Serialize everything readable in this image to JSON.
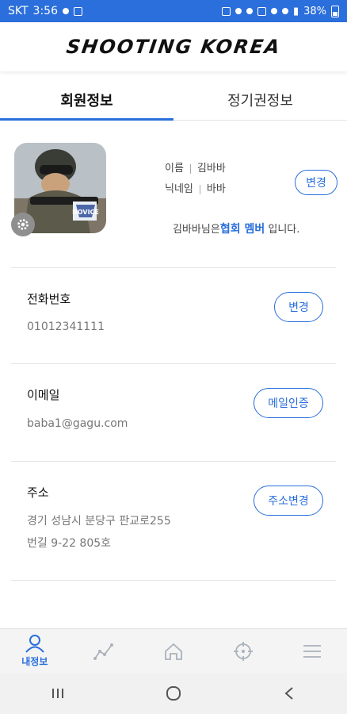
{
  "status_bar": {
    "carrier": "SKT",
    "time": "3:56",
    "battery": "38%"
  },
  "header": {
    "logo_text": "SHOOTING KOREA"
  },
  "tabs": [
    {
      "label": "회원정보",
      "active": true
    },
    {
      "label": "정기권정보",
      "active": false
    }
  ],
  "profile": {
    "avatar_badge_text": "NOVICE",
    "name_label": "이름",
    "name_value": "김바바",
    "nickname_label": "닉네임",
    "nickname_value": "바바",
    "change_button": "변경",
    "member_prefix": "김바바님은",
    "member_grade": "협회 멤버",
    "member_suffix": "입니다."
  },
  "phone": {
    "title": "전화번호",
    "value": "01012341111",
    "button": "변경"
  },
  "email": {
    "title": "이메일",
    "value": "baba1@gagu.com",
    "button": "메일인증"
  },
  "address": {
    "title": "주소",
    "line1": "경기 성남시 분당구 판교로255",
    "line2": "번길 9-22 805호",
    "button": "주소변경"
  },
  "bottom_nav": [
    {
      "label": "내정보",
      "icon": "person-icon",
      "active": true
    },
    {
      "label": "",
      "icon": "chart-line-icon",
      "active": false
    },
    {
      "label": "",
      "icon": "home-icon",
      "active": false
    },
    {
      "label": "",
      "icon": "crosshair-icon",
      "active": false
    },
    {
      "label": "",
      "icon": "menu-icon",
      "active": false
    }
  ],
  "colors": {
    "accent": "#2a6fdb",
    "status_bar": "#2a6fdb"
  }
}
